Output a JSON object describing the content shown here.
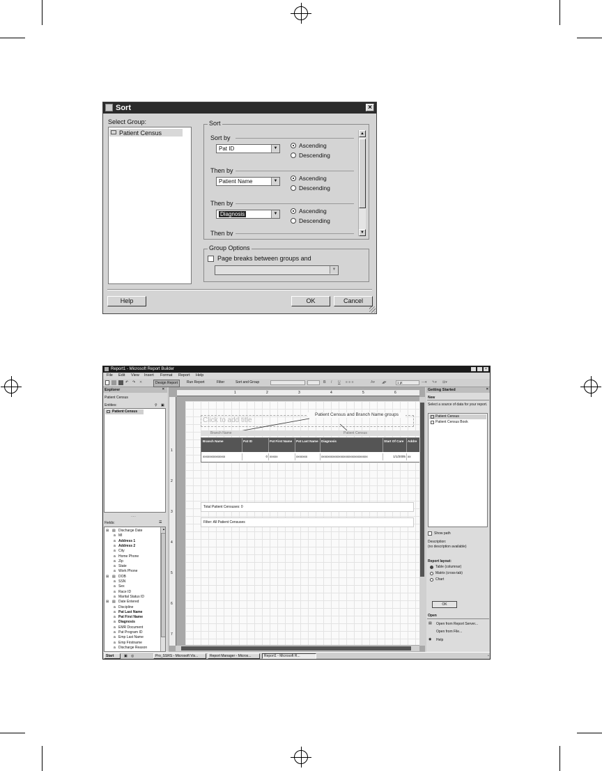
{
  "sort_dialog": {
    "title": "Sort",
    "select_group_label": "Select Group:",
    "groups": [
      "Patient Census"
    ],
    "sort_section_label": "Sort",
    "rows": [
      {
        "label": "Sort by",
        "field": "Pat ID",
        "order": "Ascending"
      },
      {
        "label": "Then by",
        "field": "Patient Name",
        "order": "Ascending"
      },
      {
        "label": "Then by",
        "field": "Diagnosis",
        "order": "Ascending"
      }
    ],
    "ascending_label": "Ascending",
    "descending_label": "Descending",
    "next_row_label": "Then by",
    "group_options_label": "Group Options",
    "page_breaks_label": "Page breaks between groups and",
    "help_label": "Help",
    "ok_label": "OK",
    "cancel_label": "Cancel"
  },
  "report_builder": {
    "window_title": "Report1 - Microsoft Report Builder",
    "menu": [
      "File",
      "Edit",
      "View",
      "Insert",
      "Format",
      "Report",
      "Help"
    ],
    "toolbar": {
      "design_report": "Design Report",
      "run_report": "Run Report",
      "filter": "Filter",
      "sort_group": "Sort and Group",
      "size": "1 pt"
    },
    "explorer": {
      "title": "Explorer",
      "current": "Patient Census",
      "entities_label": "Entities:",
      "entity": "Patient Census",
      "fields_label": "Fields:",
      "fields": [
        {
          "name": "Discharge Date",
          "bold": false,
          "group": true
        },
        {
          "name": "MI",
          "bold": false,
          "group": false
        },
        {
          "name": "Address 1",
          "bold": true,
          "group": false
        },
        {
          "name": "Address 2",
          "bold": true,
          "group": false
        },
        {
          "name": "City",
          "bold": false,
          "group": false
        },
        {
          "name": "Home Phone",
          "bold": false,
          "group": false
        },
        {
          "name": "Zip",
          "bold": false,
          "group": false
        },
        {
          "name": "State",
          "bold": false,
          "group": false
        },
        {
          "name": "Work Phone",
          "bold": false,
          "group": false
        },
        {
          "name": "DOB",
          "bold": false,
          "group": true
        },
        {
          "name": "SSN",
          "bold": false,
          "group": false
        },
        {
          "name": "Sex",
          "bold": false,
          "group": false
        },
        {
          "name": "Race ID",
          "bold": false,
          "group": false
        },
        {
          "name": "Marital Status ID",
          "bold": false,
          "group": false
        },
        {
          "name": "Date Entered",
          "bold": false,
          "group": true
        },
        {
          "name": "Discipline",
          "bold": false,
          "group": false
        },
        {
          "name": "Pat Last Name",
          "bold": true,
          "group": false
        },
        {
          "name": "Pat First Name",
          "bold": true,
          "group": false
        },
        {
          "name": "Diagnosis",
          "bold": true,
          "group": false
        },
        {
          "name": "EMR Document",
          "bold": false,
          "group": false
        },
        {
          "name": "Pat Program ID",
          "bold": false,
          "group": false
        },
        {
          "name": "Emp Last Name",
          "bold": false,
          "group": false
        },
        {
          "name": "Emp Firstname",
          "bold": false,
          "group": false
        },
        {
          "name": "Discharge Reason",
          "bold": false,
          "group": false
        }
      ]
    },
    "design": {
      "title_placeholder": "Click to add title",
      "callout": "Patient Census and Branch Name groups",
      "group_labels": [
        "Branch Name",
        "Patient Census"
      ],
      "table_headers": [
        "Branch Name",
        "Pat ID",
        "Pat First Name",
        "Pat Last Name",
        "Diagnosis",
        "Start Of Care",
        "Addre"
      ],
      "table_row": [
        "xxxxxxxxxxxxxx",
        "0",
        "xxxxx",
        "xxxxxxx",
        "xxxxxxxxxxxxxxxxxxxxxxxxxxxxx",
        "1/1/2005",
        "xx"
      ],
      "total_text": "Total Patient Censuses: 0",
      "filter_text": "Filter: All Patient Censuses"
    },
    "getting_started": {
      "title": "Getting Started",
      "new_label": "New",
      "select_source": "Select a source of data for your report.",
      "sources": [
        "Patient Census",
        "Patient Census Book"
      ],
      "show_path": "Show path",
      "description_label": "Description:",
      "description_value": "(no description available)",
      "layout_label": "Report layout:",
      "layouts": [
        "Table (columnar)",
        "Matrix (cross-tab)",
        "Chart"
      ],
      "ok_label": "OK",
      "open_label": "Open",
      "open_server": "Open from Report Server...",
      "open_file": "Open from File...",
      "help": "Help"
    },
    "taskbar": {
      "start": "Start",
      "items": [
        "Pro_SSRS - Microsoft Vis...",
        "Report Manager - Micros...",
        "Report1 - Microsoft R..."
      ]
    }
  }
}
